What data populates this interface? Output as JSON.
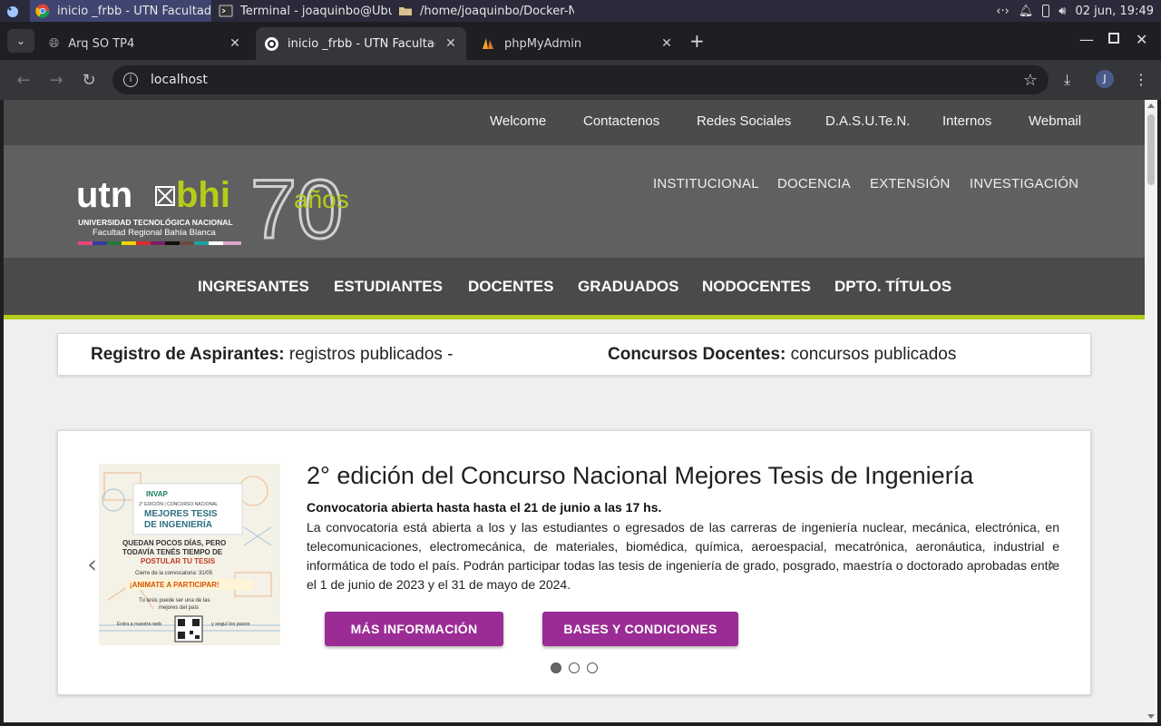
{
  "taskbar": {
    "apps": [
      {
        "label": "inicio _frbb - UTN Facultad R..."
      },
      {
        "label": "Terminal - joaquinbo@Ubun..."
      },
      {
        "label": "/home/joaquinbo/Docker-N..."
      }
    ],
    "clock": "02 jun, 19:49"
  },
  "browser": {
    "tabs": [
      {
        "title": "Arq SO TP4"
      },
      {
        "title": "inicio _frbb - UTN Facultad Re"
      },
      {
        "title": "phpMyAdmin"
      }
    ],
    "url": "localhost",
    "profile_initial": "J"
  },
  "site": {
    "top_links": [
      "Welcome",
      "Contactenos",
      "Redes Sociales",
      "D.A.S.U.Te.N.",
      "Internos",
      "Webmail"
    ],
    "logo": {
      "brand_left": "utn",
      "brand_right": "bhi",
      "line1": "UNIVERSIDAD TECNOLÓGICA NACIONAL",
      "line2": "Facultad Regional Bahía Blanca",
      "anniv_number": "70",
      "anniv_word": "años"
    },
    "inst_links": [
      "INSTITUCIONAL",
      "DOCENCIA",
      "EXTENSIÓN",
      "INVESTIGACIÓN"
    ],
    "main_links": [
      "INGRESANTES",
      "ESTUDIANTES",
      "DOCENTES",
      "GRADUADOS",
      "NODOCENTES",
      "DPTO. TÍTULOS"
    ],
    "announce": {
      "left_label": "Registro de Aspirantes:",
      "left_text": "registros publicados -",
      "right_label": "Concursos Docentes:",
      "right_text": "concursos publicados"
    },
    "slide": {
      "title": "2° edición del Concurso Nacional Mejores Tesis de Ingeniería",
      "subtitle": "Convocatoria abierta hasta hasta el 21 de junio a las 17 hs.",
      "body": "La convocatoria está abierta a los y las estudiantes o egresados de las carreras de ingeniería nuclear, mecánica, electrónica, en telecomunicaciones, electromecánica, de materiales, biomédica, química, aeroespacial, mecatrónica, aeronáutica, industrial e informática de todo el país. Podrán participar todas las tesis de ingeniería de grado, posgrado, maestría o doctorado aprobadas entre el 1 de junio de 2023 y el 31 de mayo de 2024.",
      "btn_more": "MÁS INFORMACIÓN",
      "btn_bases": "BASES Y CONDICIONES",
      "active_dot": 1,
      "poster": {
        "org": "INVAP",
        "edition": "2° EDICIÓN | CONCURSO NACIONAL",
        "headline1": "MEJORES TESIS",
        "headline2": "DE INGENIERÍA",
        "tag1": "QUEDAN POCOS DÍAS, PERO",
        "tag2": "TODAVÍA TENÉS TIEMPO DE",
        "tag3": "POSTULAR TU TESIS",
        "cierre": "Cierre de la convocatoria: 31/05",
        "cta": "¡ANIMATE A PARTICIPAR!",
        "note1": "Tu tesis puede ser una de las",
        "note2": "mejores del país",
        "web": "Entra a nuestra web",
        "follow": "y seguí los pasos"
      }
    }
  },
  "colors": {
    "accent_lime": "#b5cc18",
    "button_purple": "#9b2c95",
    "header_gray": "#606060",
    "nav_dark": "#4b4b4b"
  }
}
